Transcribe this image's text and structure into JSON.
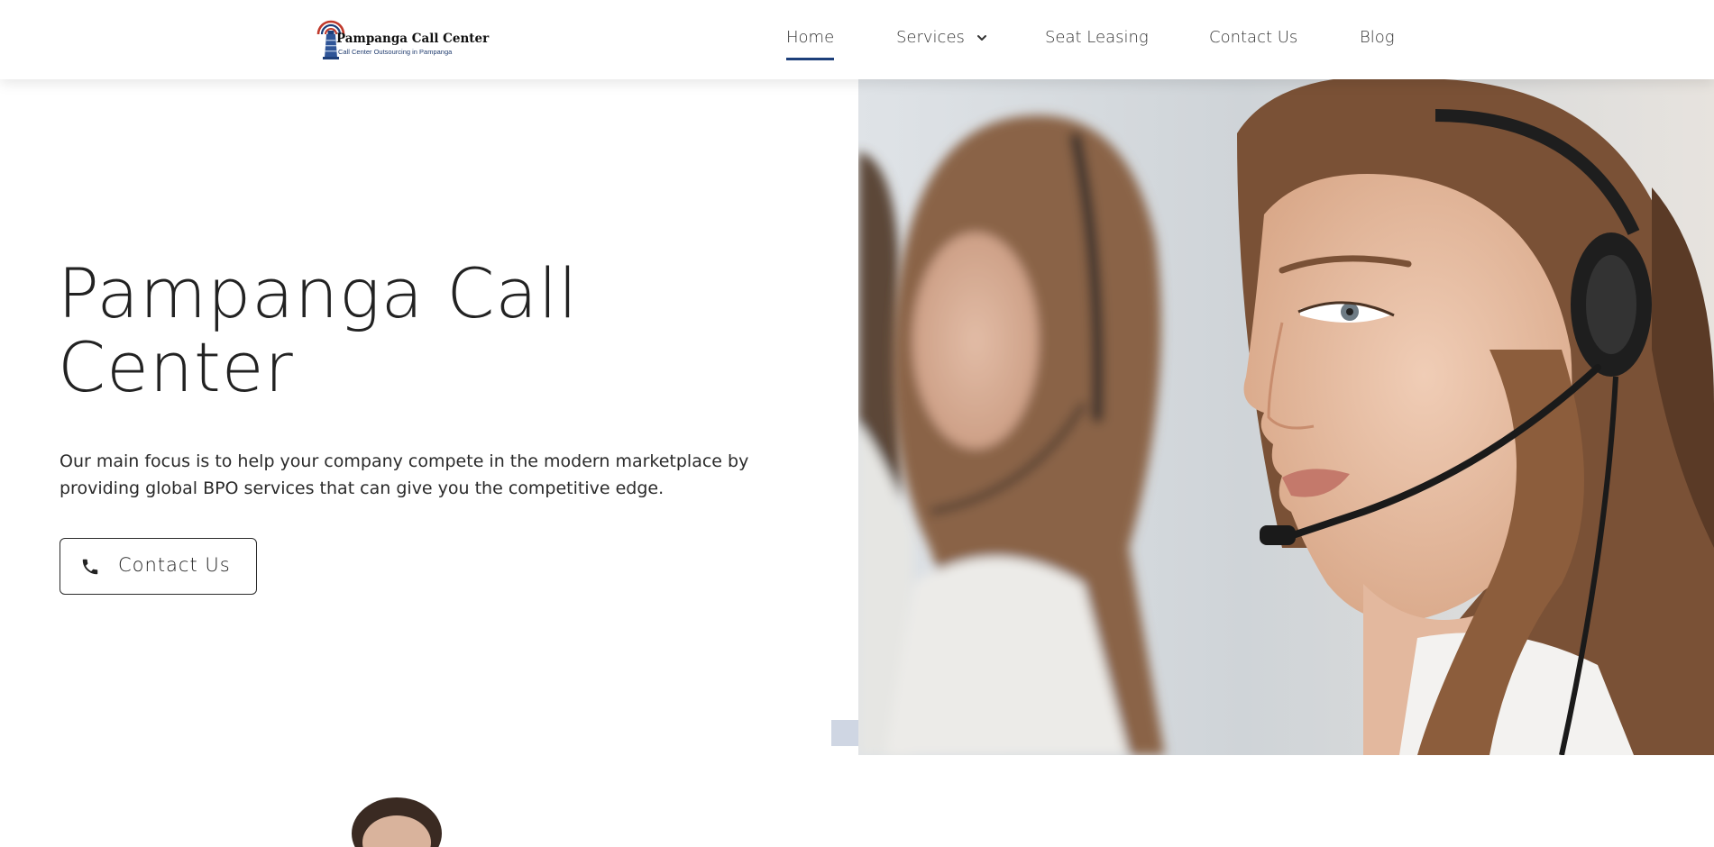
{
  "header": {
    "logo": {
      "title": "Pampanga Call Center",
      "tagline": "Call Center Outsourcing in Pampanga",
      "icon": "lighthouse-logo-icon"
    },
    "nav": [
      {
        "label": "Home",
        "active": true
      },
      {
        "label": "Services",
        "active": false,
        "has_dropdown": true,
        "dropdown_icon": "chevron-down-icon"
      },
      {
        "label": "Seat Leasing",
        "active": false
      },
      {
        "label": "Contact Us",
        "active": false
      },
      {
        "label": "Blog",
        "active": false
      }
    ]
  },
  "hero": {
    "title_line1": "Pampanga Call",
    "title_line2": "Center",
    "description": "Our main focus is to help your company compete in the modern marketplace by providing global BPO services that can give you the competitive edge.",
    "cta": {
      "label": "Contact Us",
      "icon": "phone-icon"
    },
    "image": "two-women-with-headsets-photo"
  },
  "colors": {
    "accent": "#1d3f7a",
    "text": "#222222",
    "slider_tab": "#cfd6e3",
    "background": "#ffffff"
  }
}
